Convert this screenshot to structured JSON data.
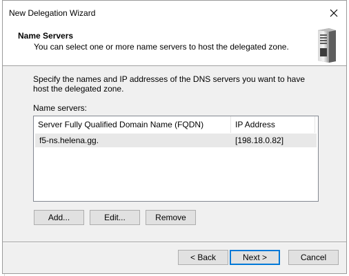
{
  "window": {
    "title": "New Delegation Wizard"
  },
  "header": {
    "title": "Name Servers",
    "subtitle": "You can select one or more name servers to host the delegated zone."
  },
  "body": {
    "description": "Specify the names and IP addresses of the DNS servers you want to have host the delegated zone.",
    "list_label": "Name servers:"
  },
  "table": {
    "columns": [
      "Server Fully Qualified Domain Name (FQDN)",
      "IP Address"
    ],
    "rows": [
      {
        "fqdn": "f5-ns.helena.gg.",
        "ip": "[198.18.0.82]"
      }
    ]
  },
  "buttons": {
    "add": "Add...",
    "edit": "Edit...",
    "remove": "Remove",
    "back": "< Back",
    "next": "Next >",
    "cancel": "Cancel"
  },
  "icons": {
    "close": "close-icon",
    "server": "server-tower-icon"
  },
  "colors": {
    "dialog_bg": "#f0f0f0",
    "header_bg": "#ffffff",
    "selected_row": "#e8e8e8",
    "default_button_border": "#0078d7"
  }
}
